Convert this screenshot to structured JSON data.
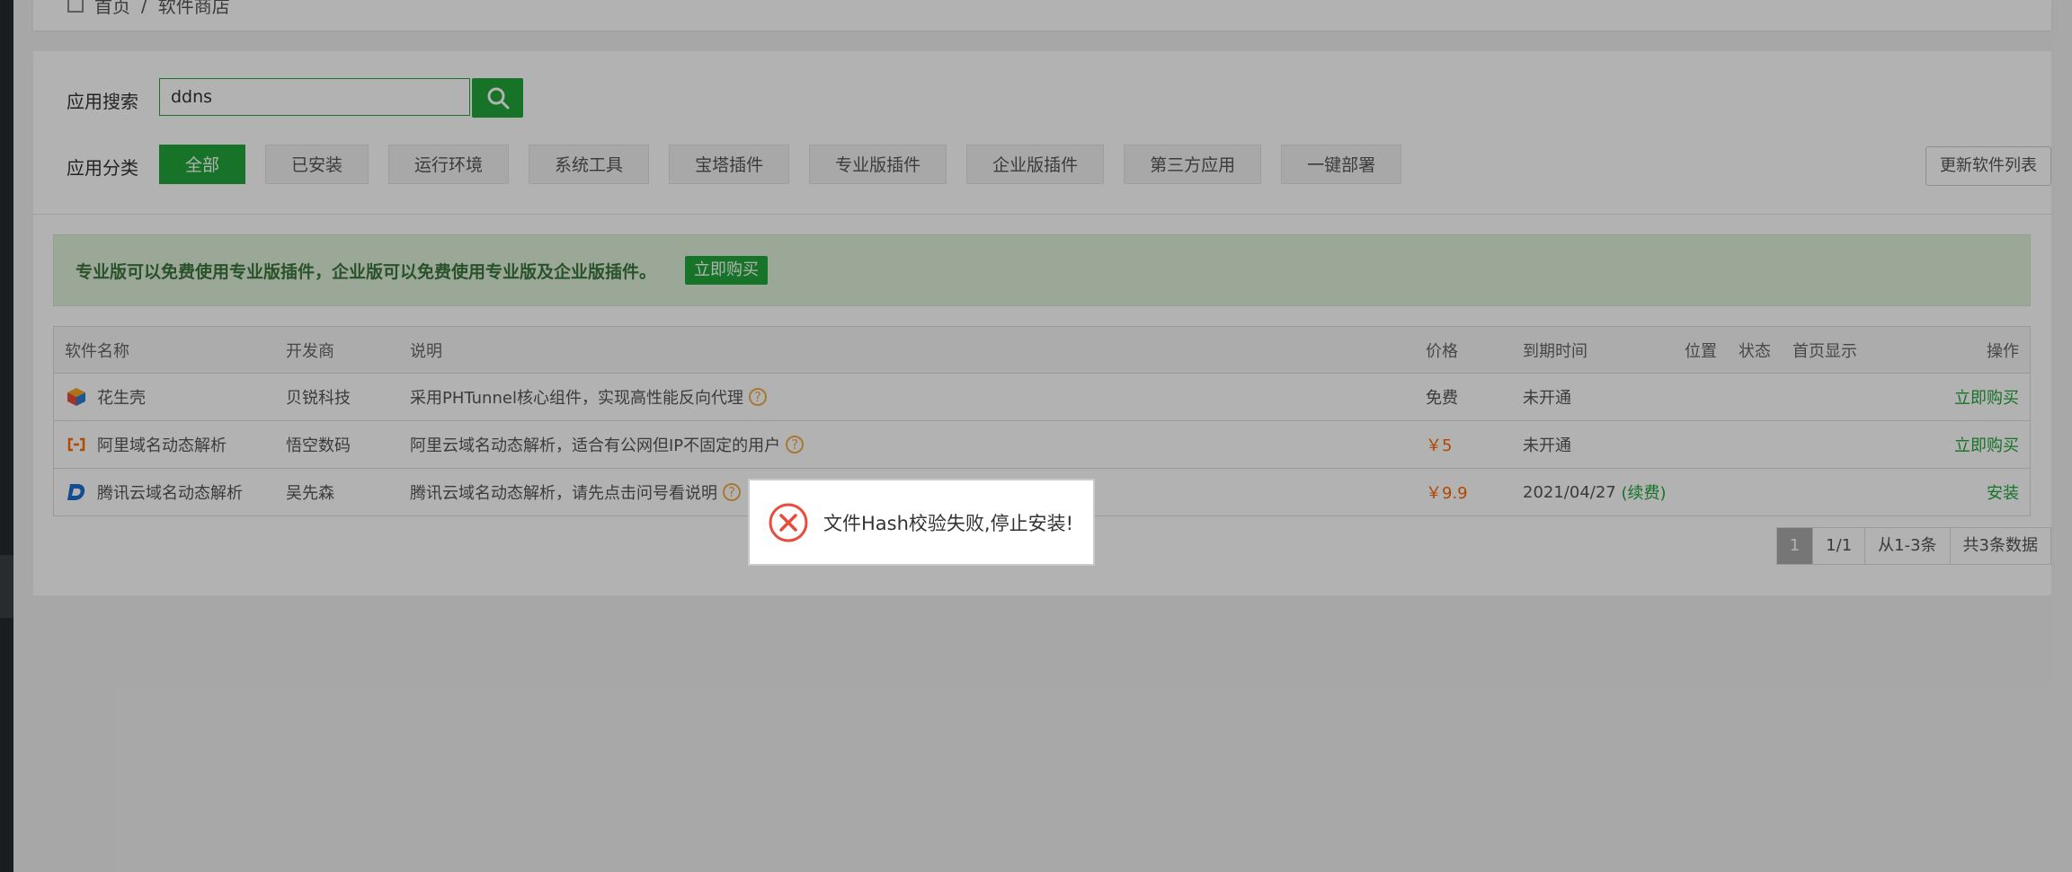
{
  "breadcrumb": {
    "home": "首页",
    "sep": "/",
    "current": "软件商店"
  },
  "search": {
    "label": "应用搜索",
    "value": "ddns"
  },
  "category": {
    "label": "应用分类",
    "items": [
      "全部",
      "已安装",
      "运行环境",
      "系统工具",
      "宝塔插件",
      "专业版插件",
      "企业版插件",
      "第三方应用",
      "一键部署"
    ],
    "refresh": "更新软件列表"
  },
  "tip": {
    "text": "专业版可以免费使用专业版插件，企业版可以免费使用专业版及企业版插件。",
    "buy": "立即购买"
  },
  "table": {
    "headers": [
      "软件名称",
      "开发商",
      "说明",
      "价格",
      "到期时间",
      "位置",
      "状态",
      "首页显示",
      "操作"
    ],
    "rows": [
      {
        "name": "花生壳",
        "dev": "贝锐科技",
        "desc": "采用PHTunnel核心组件，实现高性能反向代理",
        "price": "免费",
        "expire": "未开通",
        "renew": "",
        "action": "立即购买"
      },
      {
        "name": "阿里域名动态解析",
        "dev": "悟空数码",
        "desc": "阿里云域名动态解析，适合有公网但IP不固定的用户",
        "price": "￥5",
        "expire": "未开通",
        "renew": "",
        "action": "立即购买"
      },
      {
        "name": "腾讯云域名动态解析",
        "dev": "吴先森",
        "desc": "腾讯云域名动态解析，请先点击问号看说明",
        "price": "￥9.9",
        "expire": "2021/04/27",
        "renew": "(续费)",
        "action": "安装"
      }
    ]
  },
  "pager": {
    "current": "1",
    "pages": "1/1",
    "range": "从1-3条",
    "total": "共3条数据"
  },
  "toast": {
    "message": "文件Hash校验失败,停止安装!"
  },
  "colors": {
    "accent": "#20a53a",
    "error": "#e74c3c",
    "price": "#ff6600"
  }
}
